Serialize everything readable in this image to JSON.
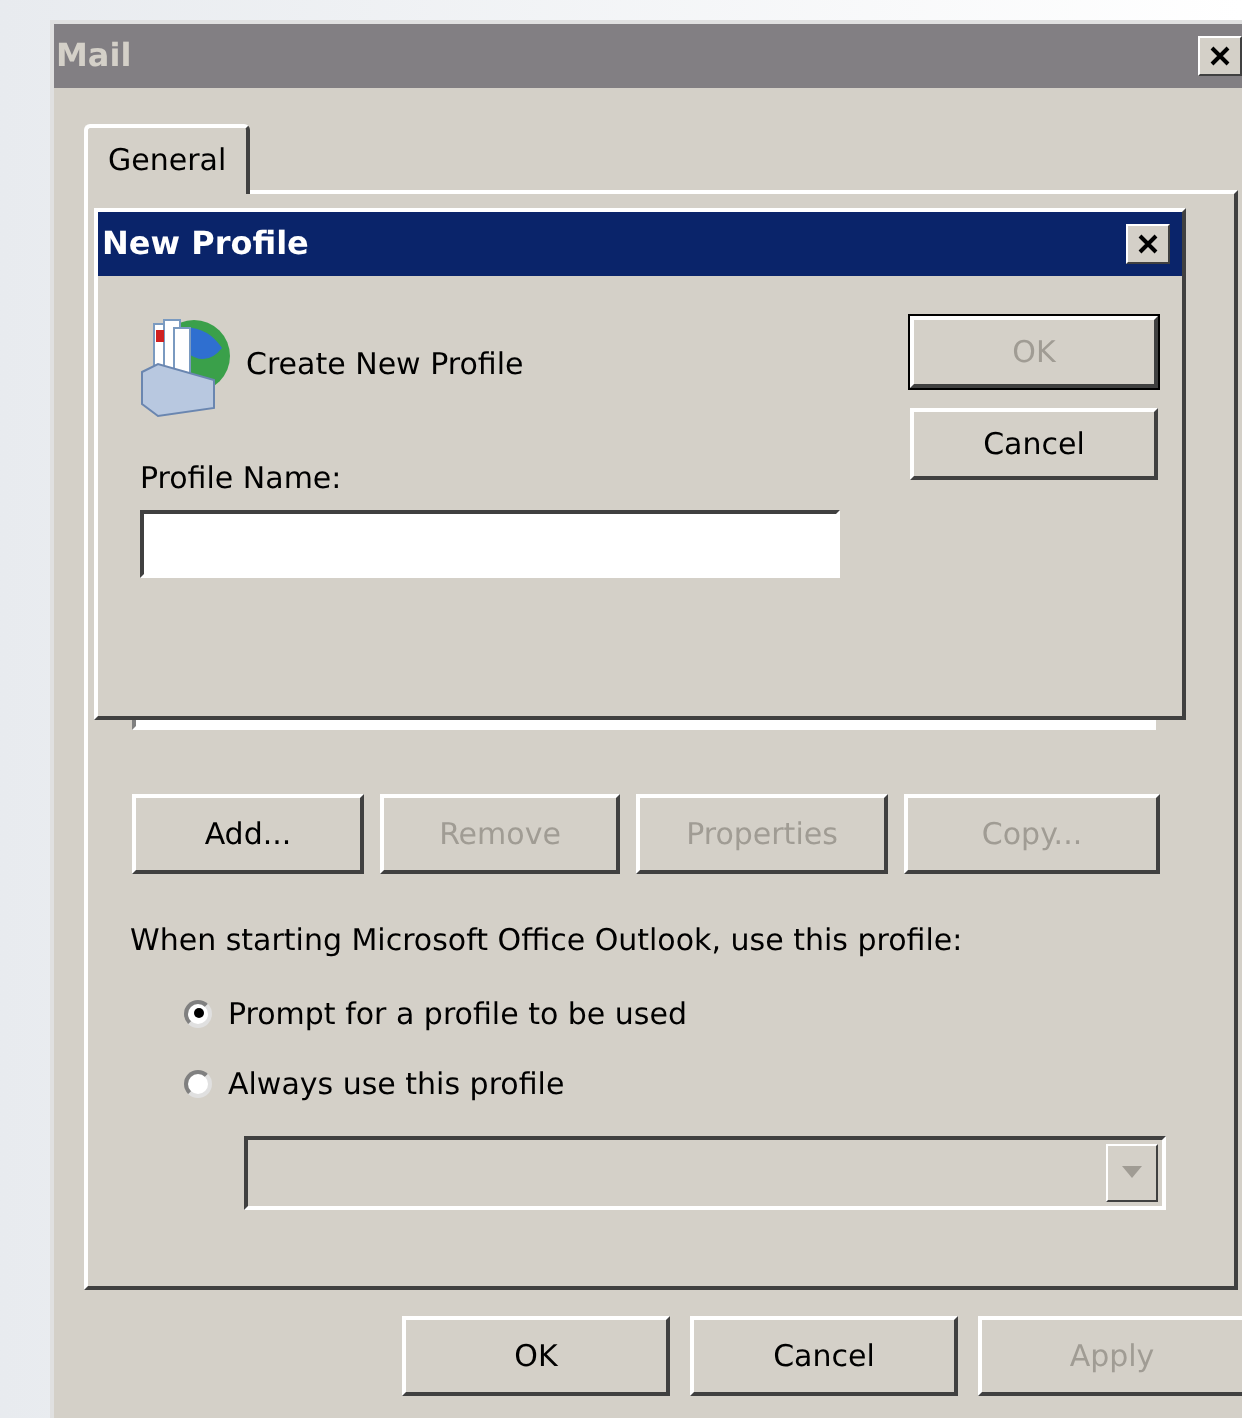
{
  "window": {
    "title": "Mail",
    "active": false
  },
  "tabs": [
    {
      "label": "General",
      "selected": true
    }
  ],
  "profile_buttons": [
    {
      "label": "Add...",
      "disabled": false
    },
    {
      "label": "Remove",
      "disabled": true
    },
    {
      "label": "Properties",
      "disabled": true
    },
    {
      "label": "Copy...",
      "disabled": true
    }
  ],
  "startup": {
    "label": "When starting Microsoft Office Outlook, use this profile:",
    "options": [
      {
        "label": "Prompt for a profile to be used",
        "selected": true
      },
      {
        "label": "Always use this profile",
        "selected": false
      }
    ],
    "profile_select": {
      "disabled": true
    }
  },
  "buttons": [
    {
      "label": "OK",
      "disabled": false
    },
    {
      "label": "Cancel",
      "disabled": false
    },
    {
      "label": "Apply",
      "disabled": true
    }
  ],
  "dialog": {
    "title": "New Profile",
    "active": true,
    "heading": "Create New Profile",
    "field_label": "Profile Name:",
    "buttons": [
      {
        "label": "OK",
        "disabled": true,
        "default": true
      },
      {
        "label": "Cancel",
        "disabled": false,
        "default": false
      }
    ]
  }
}
